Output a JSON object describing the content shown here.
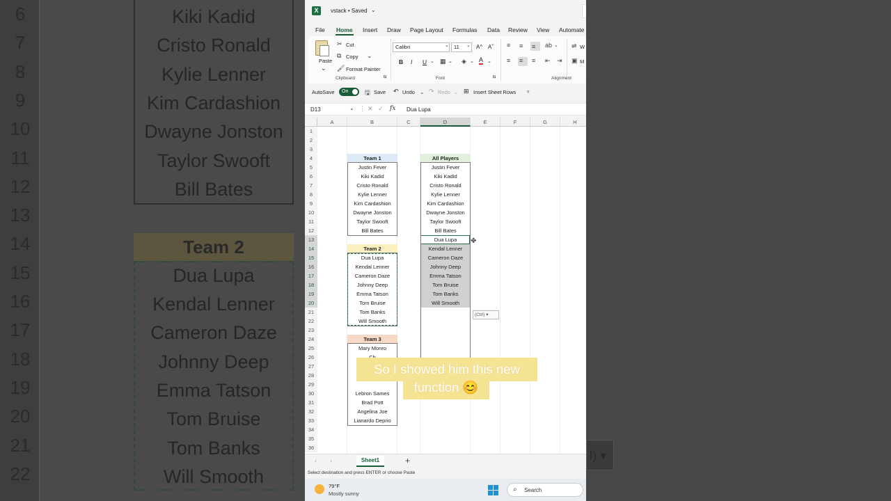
{
  "background": {
    "row_numbers": [
      "6",
      "7",
      "8",
      "9",
      "10",
      "11",
      "12",
      "13",
      "14",
      "15",
      "16",
      "17",
      "18",
      "19",
      "20",
      "21",
      "22"
    ],
    "team1_names": [
      "Kiki Kadid",
      "Cristo Ronald",
      "Kylie Lenner",
      "Kim Cardashion",
      "Dwayne Jonston",
      "Taylor Swooft",
      "Bill Bates"
    ],
    "team2_header": "Team 2",
    "team2_names": [
      "Dua Lupa",
      "Kendal Lenner",
      "Cameron Daze",
      "Johnny Deep",
      "Emma Tatson",
      "Tom Bruise",
      "Tom Banks",
      "Will Smooth"
    ],
    "ctrl_fragment": "l) ▾"
  },
  "titlebar": {
    "app_icon": "X",
    "title": "vstack • Saved",
    "chevron": "⌄"
  },
  "menu": [
    "File",
    "Home",
    "Insert",
    "Draw",
    "Page Layout",
    "Formulas",
    "Data",
    "Review",
    "View",
    "Automate"
  ],
  "ribbon": {
    "paste": "Paste",
    "cut": "Cut",
    "copy": "Copy",
    "format_painter": "Format Painter",
    "clipboard": "Clipboard",
    "font_name": "Calibri",
    "font_size": "11",
    "font_group": "Font",
    "alignment_group": "Alignment",
    "grow": "A^",
    "shrink": "Aˇ",
    "bold": "B",
    "italic": "I",
    "underline": "U",
    "wrap_fragment": "W",
    "merge_fragment": "M"
  },
  "qat": {
    "autosave": "AutoSave",
    "toggle": "On",
    "save": "Save",
    "undo": "Undo",
    "redo": "Redo",
    "insert_rows": "Insert Sheet Rows"
  },
  "formula_bar": {
    "cell_ref": "D13",
    "fx": "fx",
    "value": "Dua Lupa"
  },
  "columns": [
    "A",
    "B",
    "C",
    "D",
    "E",
    "F",
    "G",
    "H"
  ],
  "rows": [
    "1",
    "2",
    "3",
    "4",
    "5",
    "6",
    "7",
    "8",
    "9",
    "10",
    "11",
    "12",
    "13",
    "14",
    "15",
    "16",
    "17",
    "18",
    "19",
    "20",
    "21",
    "22",
    "23",
    "24",
    "25",
    "26",
    "27",
    "28",
    "29",
    "30",
    "31",
    "32",
    "33",
    "34",
    "35",
    "36"
  ],
  "team1": {
    "header": "Team 1",
    "names": [
      "Justin Fever",
      "Kiki Kadid",
      "Cristo Ronald",
      "Kylie Lenner",
      "Kim Cardashion",
      "Dwayne Jonston",
      "Taylor Swooft",
      "Bill Bates"
    ],
    "color": "#dce9f7"
  },
  "team2": {
    "header": "Team 2",
    "names": [
      "Dua Lupa",
      "Kendal Lenner",
      "Cameron Daze",
      "Johnny Deep",
      "Emma Tatson",
      "Tom Bruise",
      "Tom Banks",
      "Will Smooth"
    ],
    "color": "#fbefc0"
  },
  "team3": {
    "header": "Team 3",
    "names": [
      "Mary Monro",
      "Ch",
      "",
      "",
      "",
      "Lebron Sames",
      "Brad Pott",
      "Angelina Joe",
      "Lianardo Deprio"
    ],
    "color": "#f8d9c8"
  },
  "all_players": {
    "header": "All Players",
    "names": [
      "Justin Fever",
      "Kiki Kadid",
      "Cristo Ronald",
      "Kylie Lenner",
      "Kim Cardashion",
      "Dwayne Jonston",
      "Taylor Swooft",
      "Bill Bates",
      "Dua Lupa",
      "Kendal Lenner",
      "Cameron Daze",
      "Johnny Deep",
      "Emma Tatson",
      "Tom Bruise",
      "Tom Banks",
      "Will Smooth"
    ],
    "color": "#e2efda"
  },
  "fragments": {
    "row27": "A",
    "row28": "A"
  },
  "paste_options": "(Ctrl) ▾",
  "caption": {
    "line1": "So I showed him this new",
    "line2": "function 😊"
  },
  "sheet": {
    "name": "Sheet1",
    "add": "+"
  },
  "status": "Select destination and press ENTER or choose Paste",
  "taskbar": {
    "temperature": "79°F",
    "weather": "Mostly sunny",
    "search": "Search"
  }
}
